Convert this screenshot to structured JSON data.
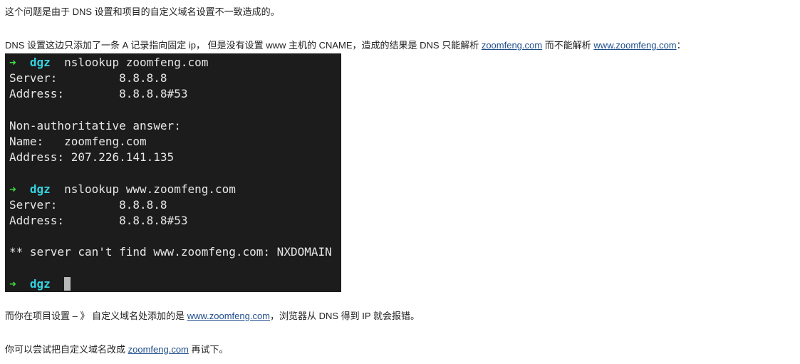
{
  "paragraph_1": {
    "text": "这个问题是由于 DNS 设置和项目的自定义域名设置不一致造成的。"
  },
  "paragraph_2": {
    "text_a": "DNS 设置这边只添加了一条 A 记录指向固定 ip， 但是没有设置 www 主机的 CNAME，造成的结果是 DNS 只能解析 ",
    "link_1": "zoomfeng.com",
    "text_b": " 而不能解析 ",
    "link_2": "www.zoomfeng.com",
    "text_c": "："
  },
  "terminal": {
    "prompt_arrow": "➜",
    "prompt_user": "dgz",
    "lines": [
      {
        "type": "cmd",
        "text": "nslookup zoomfeng.com"
      },
      {
        "type": "out",
        "text": "Server:\t\t8.8.8.8"
      },
      {
        "type": "out",
        "text": "Address:\t8.8.8.8#53"
      },
      {
        "type": "out",
        "text": ""
      },
      {
        "type": "out",
        "text": "Non-authoritative answer:"
      },
      {
        "type": "out",
        "text": "Name:\tzoomfeng.com"
      },
      {
        "type": "out",
        "text": "Address: 207.226.141.135"
      },
      {
        "type": "out",
        "text": ""
      },
      {
        "type": "cmd",
        "text": "nslookup www.zoomfeng.com"
      },
      {
        "type": "out",
        "text": "Server:\t\t8.8.8.8"
      },
      {
        "type": "out",
        "text": "Address:\t8.8.8.8#53"
      },
      {
        "type": "out",
        "text": ""
      },
      {
        "type": "out",
        "text": "** server can't find www.zoomfeng.com: NXDOMAIN"
      },
      {
        "type": "out",
        "text": ""
      },
      {
        "type": "prompt",
        "text": ""
      }
    ]
  },
  "paragraph_3": {
    "text_a": "而你在项目设置 – 》 自定义域名处添加的是 ",
    "link": "www.zoomfeng.com",
    "text_b": "，浏览器从 DNS 得到 IP 就会报错。"
  },
  "paragraph_4": {
    "text_a": "你可以尝试把自定义域名改成 ",
    "link": "zoomfeng.com",
    "text_b": " 再试下。"
  }
}
